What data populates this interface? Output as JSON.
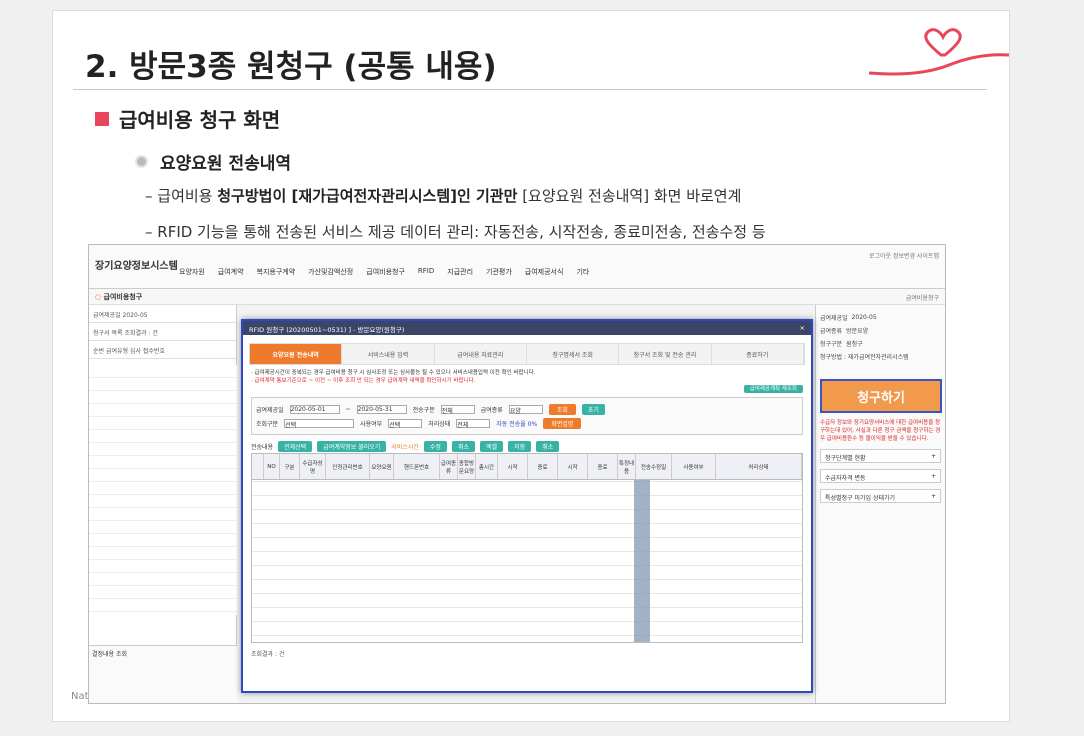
{
  "slide": {
    "title": "2. 방문3종 원청구 (공통 내용)",
    "heading1": "급여비용 청구 화면",
    "heading2": "요양요원 전송내역",
    "bullet1": {
      "dash": "–",
      "pre": "급여비용 ",
      "bold": "청구방법이 [재가급여전자관리시스템]인 기관만",
      "post": " [요양요원 전송내역] 화면 바로연계"
    },
    "bullet2": "– RFID 기능을 통해 전송된 서비스 제공 데이터 관리: 자동전송, 시작전송, 종료미전송, 전송수정 등",
    "footer": "National He"
  },
  "app": {
    "logo": "장기요양정보시스템",
    "top_right": "로그아웃 정보변경 사이트맵",
    "nav": [
      "요양자원",
      "급여계약",
      "복지용구계약",
      "가산및감액산정",
      "급여비용청구",
      "RFID",
      "지급관리",
      "기관평가",
      "급여제공서식",
      "기타"
    ],
    "subtitle": "급여비용청구",
    "breadcrumb": "급여비용청구",
    "left": {
      "row1": "급여제공일 2020-05",
      "row2": "청구서 목록  조회결과 : 건",
      "row3": "순번  급여유형  심사 접수번호",
      "bottom": "결정내용 조회"
    },
    "right": {
      "f1_label": "급여제공일",
      "f1_value": "2020-05",
      "f2_label": "급여종류",
      "f2_value": "방문요양",
      "f3_label": "청구구분",
      "f3_value": "원청구",
      "method": "청구방법 : 재가급여전자관리시스템",
      "claim_button": "청구하기",
      "warning": "수급자 정보와 장기요양서비스에 대한 급여비용을 청구하는데 있어, 사실과 다른 청구 금액을 청구하는 경우 급여비용환수 등 불이익을 받을 수 있습니다.",
      "acc1": "청구단계별 현황",
      "acc2": "수급자자격 변동",
      "acc3": "특성별청구 미가입 상태가기"
    },
    "modal": {
      "title": "RFID 원청구 (20200501~0531)  ] - 방문요양(원청구)",
      "close": "×",
      "steps": [
        "요양요원 전송내역",
        "서비스내용 입력",
        "급여내용 자료관리",
        "청구명세서 조회",
        "청구서 조회 및 전송 관리",
        "종료하기"
      ],
      "notice1": "· 급여제공시간이 중복되는 경우 급여비용 청구 시 심사조정 또는 심사불능 될 수 있으니 서비스내용입력 이전 확인 바랍니다.",
      "notice2": "· 급여계약 통보기준으로 ~ 이전 ~ 이후 조회 안 되는 경우 급여계약 내역을 확인하시기 바랍니다.",
      "notice_btn": "급여제공계획 재조회",
      "filter": {
        "date_label": "급여제공일",
        "date_from": "2020-05-01",
        "date_to": "2020-05-31",
        "send_label": "전송구분",
        "send_value": "전체",
        "type_label": "급여종류",
        "type_value": "요양",
        "search": "조회",
        "reset": "초기",
        "recipient_label": "조회구분",
        "recipient_value": "선택",
        "use_label": "사용여부",
        "use_value": "선택",
        "status_label": "처리상태",
        "status_value": "전체",
        "auto_rate": "자동 전송율 0%",
        "help": "화면설명"
      },
      "table_label": "전송내용",
      "table_buttons": [
        "전체선택",
        "급여계약정보 불러오기",
        "서비스시간",
        "수정",
        "취소",
        "엑셀",
        "저장",
        "취소"
      ],
      "columns": [
        "",
        "NO",
        "구분",
        "수급자성명",
        "인정관리번호",
        "요양요원",
        "핸드폰번호",
        "급여종류",
        "종합방문요양",
        "총시간",
        "시작",
        "종료",
        "시작",
        "종료",
        "특정내용",
        "전송수정일",
        "사용여부",
        "처리상태"
      ],
      "footer": "조회결과 : 건"
    }
  }
}
